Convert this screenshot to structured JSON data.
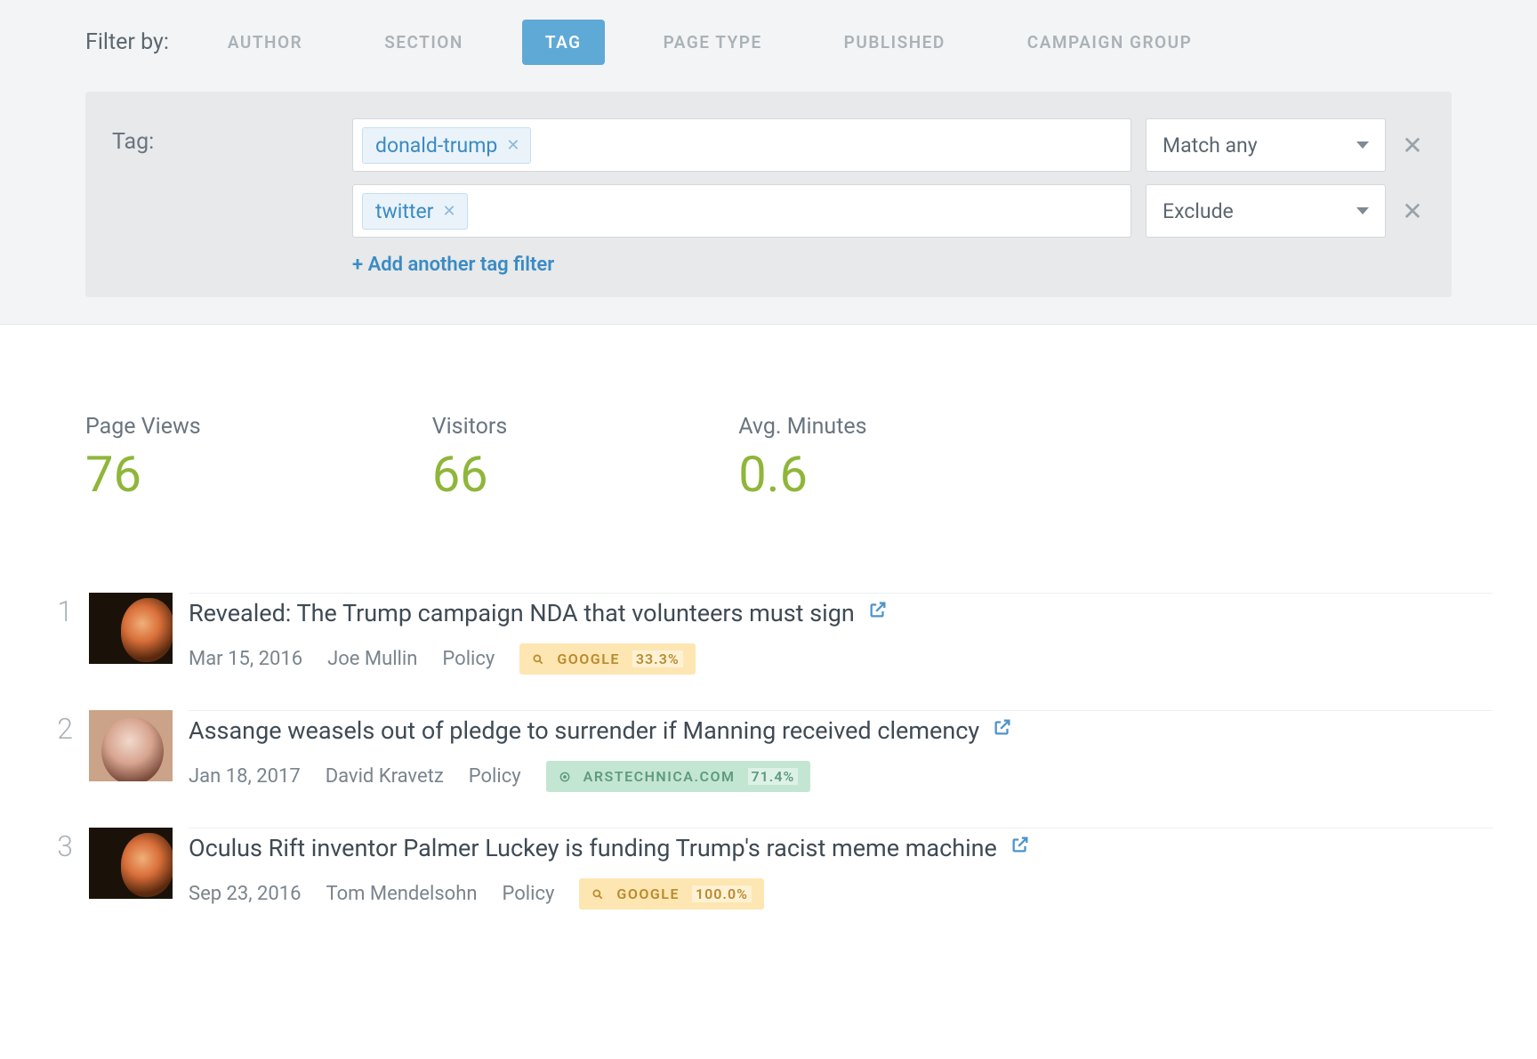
{
  "filter": {
    "label": "Filter by:",
    "tabs": [
      "Author",
      "Section",
      "Tag",
      "Page Type",
      "Published",
      "Campaign Group"
    ],
    "active_tab": "Tag"
  },
  "tag_filter": {
    "label": "Tag:",
    "rows": [
      {
        "chip": "donald-trump",
        "mode": "Match any"
      },
      {
        "chip": "twitter",
        "mode": "Exclude"
      }
    ],
    "add_another": "+ Add another tag filter"
  },
  "stats": {
    "page_views": {
      "label": "Page Views",
      "value": "76"
    },
    "visitors": {
      "label": "Visitors",
      "value": "66"
    },
    "avg_minutes": {
      "label": "Avg. Minutes",
      "value": "0.6"
    }
  },
  "articles": [
    {
      "rank": "1",
      "headline": "Revealed: The Trump campaign NDA that volunteers must sign",
      "date": "Mar 15, 2016",
      "author": "Joe Mullin",
      "section": "Policy",
      "badge": {
        "kind": "google",
        "source": "Google",
        "pct": "33.3%"
      },
      "thumb": "dark"
    },
    {
      "rank": "2",
      "headline": "Assange weasels out of pledge to surrender if Manning received clemency",
      "date": "Jan 18, 2017",
      "author": "David Kravetz",
      "section": "Policy",
      "badge": {
        "kind": "internal",
        "source": "arstechnica.com",
        "pct": "71.4%"
      },
      "thumb": "light"
    },
    {
      "rank": "3",
      "headline": "Oculus Rift inventor Palmer Luckey is funding Trump's racist meme machine",
      "date": "Sep 23, 2016",
      "author": "Tom Mendelsohn",
      "section": "Policy",
      "badge": {
        "kind": "google",
        "source": "Google",
        "pct": "100.0%"
      },
      "thumb": "dark"
    }
  ]
}
